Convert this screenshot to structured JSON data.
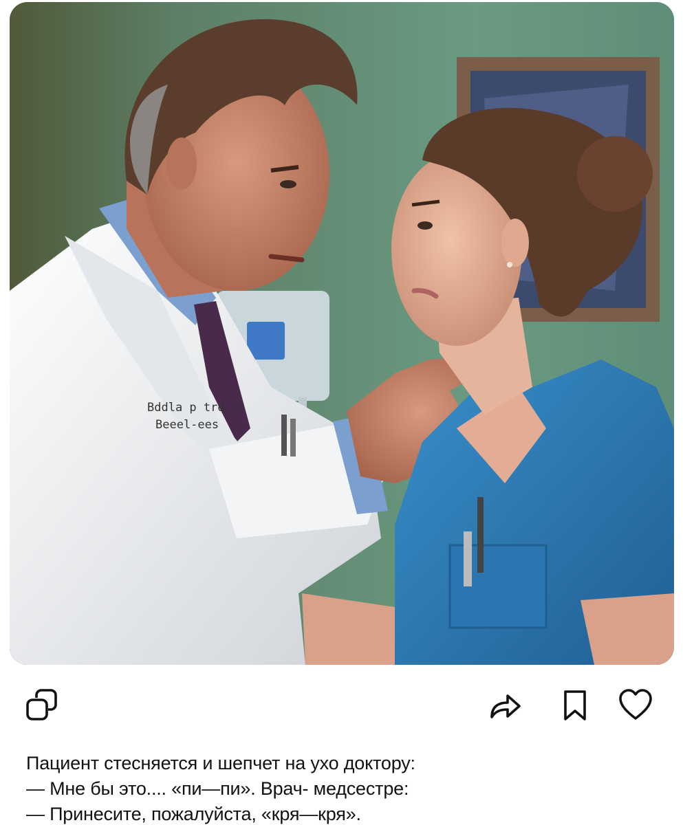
{
  "post": {
    "image": {
      "alt_icon": "photo-image",
      "badge_text_1": "Bddla p trd.l.",
      "badge_text_2": "Beeel-ees"
    },
    "actions": {
      "copy_icon": "copy-icon",
      "share_icon": "share-icon",
      "bookmark_icon": "bookmark-icon",
      "like_icon": "heart-icon"
    },
    "caption": {
      "lines": [
        "Пациент стесняется и шепчет на ухо доктору:",
        "— Мне бы это.... «пи—пи». Врач- медсестре:",
        "— Принесите, пожалуйста, «кря—кря»."
      ]
    }
  },
  "colors": {
    "background": "#ffffff",
    "text": "#111111",
    "wall": "#5e8a72",
    "scrubs": "#2f7fb8",
    "coat": "#f1f2f4"
  }
}
